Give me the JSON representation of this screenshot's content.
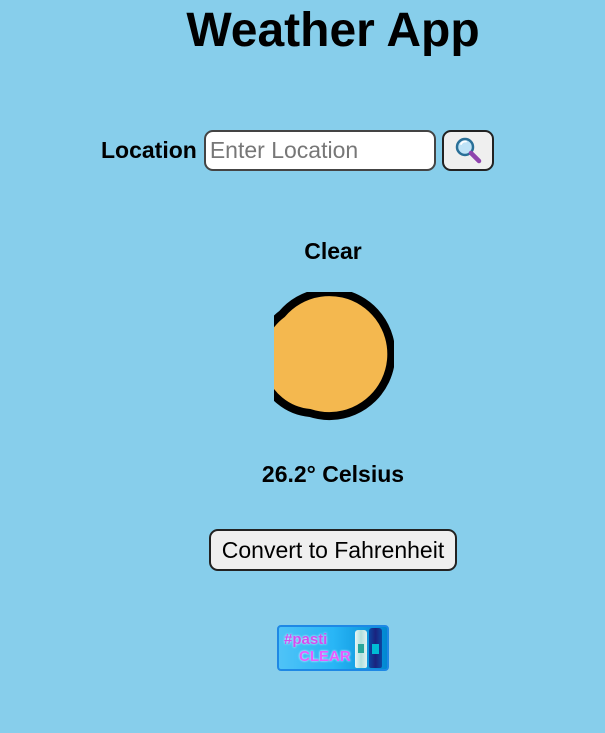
{
  "app": {
    "title": "Weather App"
  },
  "search": {
    "label": "Location",
    "placeholder": "Enter Location",
    "value": "",
    "button_icon": "search-icon"
  },
  "weather": {
    "condition": "Clear",
    "icon": "crescent-moon-icon",
    "temperature_text": "26.2° Celsius"
  },
  "actions": {
    "convert_label": "Convert to Fahrenheit"
  },
  "ad": {
    "line1": "#pasti",
    "line2": "CLEAR"
  },
  "colors": {
    "background": "#87CEEB",
    "moon_fill": "#F4B84F",
    "button_bg": "#EFEFEF"
  }
}
